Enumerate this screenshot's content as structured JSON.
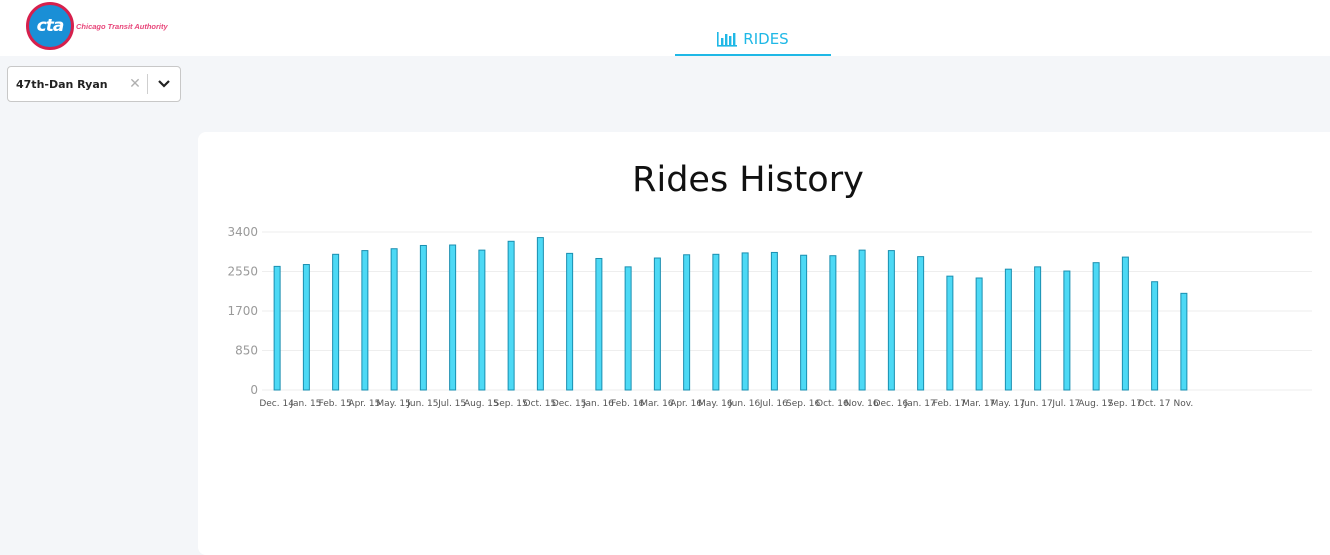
{
  "header": {
    "logo": {
      "mark": "cta",
      "text": "Chicago Transit Authority"
    },
    "tab": {
      "label": "RIDES",
      "icon": "bar-chart-icon",
      "active": true
    }
  },
  "station_select": {
    "value": "47th-Dan Ryan"
  },
  "colors": {
    "accent": "#1fb8e6",
    "bar_fill": "#4dd9f5",
    "bar_stroke": "#1a8fb0"
  },
  "chart_data": {
    "type": "bar",
    "title": "Rides History",
    "xlabel": "",
    "ylabel": "",
    "ylim": [
      0,
      3400
    ],
    "yticks": [
      0,
      850,
      1700,
      2550,
      3400
    ],
    "grid": true,
    "categories": [
      "Dec. 14",
      "Jan. 15",
      "Feb. 15",
      "Apr. 15",
      "May. 15",
      "Jun. 15",
      "Jul. 15",
      "Aug. 15",
      "Sep. 15",
      "Oct. 15",
      "Dec. 15",
      "Jan. 16",
      "Feb. 16",
      "Mar. 16",
      "Apr. 16",
      "May. 16",
      "Jun. 16",
      "Jul. 16",
      "Sep. 16",
      "Oct. 16",
      "Nov. 16",
      "Dec. 16",
      "Jan. 17",
      "Feb. 17",
      "Mar. 17",
      "May. 17",
      "Jun. 17",
      "Jul. 17",
      "Aug. 17",
      "Sep. 17",
      "Oct. 17",
      "Nov."
    ],
    "values": [
      2660,
      2700,
      2920,
      3000,
      3040,
      3110,
      3120,
      3010,
      3200,
      3280,
      2940,
      2830,
      2650,
      2840,
      2910,
      2920,
      2950,
      2960,
      2900,
      2890,
      3010,
      3000,
      2870,
      2450,
      2410,
      2600,
      2650,
      2560,
      2740,
      2860,
      2330,
      2080
    ]
  }
}
